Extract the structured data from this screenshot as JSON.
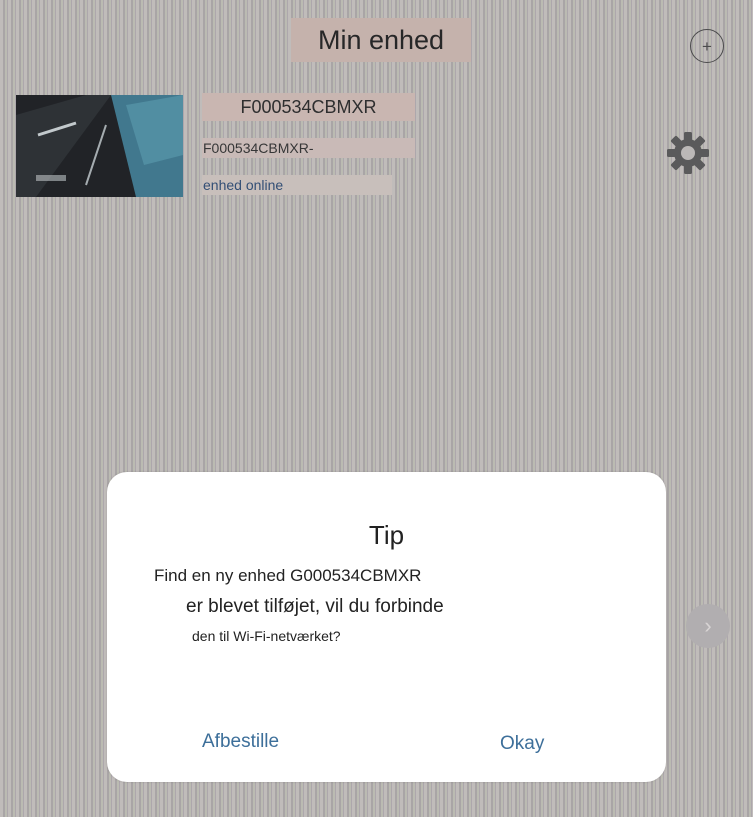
{
  "header": {
    "title": "Min enhed",
    "add_button_symbol": "+"
  },
  "device": {
    "name": "F000534CBMXR",
    "id_label": "F000534CBMXR-",
    "status": "enhed online",
    "thumbnail_icon": "camera-preview-thumbnail",
    "settings_icon": "gear-icon"
  },
  "dialog": {
    "title": "Tip",
    "message_lines": [
      "Find en ny enhed G000534CBMXR",
      "er blevet tilføjet, vil du forbinde",
      "den til Wi-Fi-netværket?"
    ],
    "cancel_label": "Afbestille",
    "ok_label": "Okay"
  },
  "background_chevron_symbol": "›",
  "colors": {
    "link_blue": "#3d6f9a",
    "status_blue": "#2f4e78",
    "header_highlight": "#d2bdb5",
    "dialog_bg": "#ffffff"
  }
}
